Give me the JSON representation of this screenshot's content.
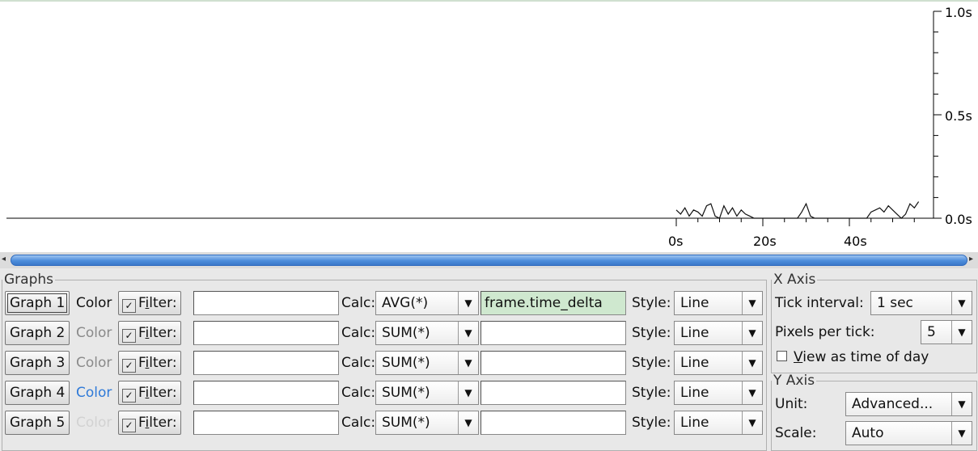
{
  "plot": {
    "y_ticks": [
      "1.0s",
      "0.5s",
      "0.0s"
    ],
    "x_ticks": [
      "0s",
      "20s",
      "40s"
    ]
  },
  "chart_data": {
    "type": "line",
    "series": [
      {
        "x": [
          0,
          1,
          2,
          3,
          4,
          5,
          6,
          7,
          8,
          9,
          10,
          11,
          12,
          13,
          14,
          15,
          16,
          17,
          18,
          19,
          20,
          21,
          22,
          23,
          24,
          25,
          26,
          27,
          28,
          29,
          30,
          31,
          32,
          33,
          34,
          35,
          36,
          37,
          38,
          39,
          40,
          41,
          42,
          43,
          44,
          45,
          46,
          47,
          48,
          49,
          50,
          51,
          52,
          53,
          54,
          55,
          56
        ],
        "values": [
          0.04,
          0.02,
          0.05,
          0.01,
          0.04,
          0.03,
          0.01,
          0.06,
          0.07,
          0.01,
          0.0,
          0.06,
          0.02,
          0.05,
          0.01,
          0.04,
          0.02,
          0.01,
          0.0,
          0.0,
          0.0,
          0.0,
          0.0,
          0.0,
          0.0,
          0.0,
          0.0,
          0.0,
          0.0,
          0.03,
          0.07,
          0.01,
          0.0,
          0.0,
          0.0,
          0.0,
          0.0,
          0.0,
          0.0,
          0.0,
          0.0,
          0.0,
          0.0,
          0.0,
          0.0,
          0.03,
          0.04,
          0.05,
          0.03,
          0.06,
          0.04,
          0.02,
          0.0,
          0.02,
          0.07,
          0.05,
          0.08
        ]
      }
    ],
    "xlim": [
      0,
      58
    ],
    "ylim": [
      0,
      1.0
    ],
    "x_unit": "s",
    "y_unit": "s"
  },
  "graphs": {
    "legend": "Graphs",
    "rows": [
      {
        "button": "Graph 1",
        "color_label": "Color",
        "color": "#111111",
        "filter_pre": "F",
        "filter_u": "i",
        "filter_post": "lter:",
        "filter_value": "",
        "calc_label": "Calc:",
        "calc": "AVG(*)",
        "field": "frame.time_delta",
        "style_label": "Style:",
        "style": "Line"
      },
      {
        "button": "Graph 2",
        "color_label": "Color",
        "color": "#8a8a8a",
        "filter_pre": "F",
        "filter_u": "i",
        "filter_post": "lter:",
        "filter_value": "",
        "calc_label": "Calc:",
        "calc": "SUM(*)",
        "field": "",
        "style_label": "Style:",
        "style": "Line"
      },
      {
        "button": "Graph 3",
        "color_label": "Color",
        "color": "#8a8a8a",
        "filter_pre": "F",
        "filter_u": "i",
        "filter_post": "lter:",
        "filter_value": "",
        "calc_label": "Calc:",
        "calc": "SUM(*)",
        "field": "",
        "style_label": "Style:",
        "style": "Line"
      },
      {
        "button": "Graph 4",
        "color_label": "Color",
        "color": "#2f7ad8",
        "filter_pre": "F",
        "filter_u": "i",
        "filter_post": "lter:",
        "filter_value": "",
        "calc_label": "Calc:",
        "calc": "SUM(*)",
        "field": "",
        "style_label": "Style:",
        "style": "Line"
      },
      {
        "button": "Graph 5",
        "color_label": "Color",
        "color": "#d2d2d2",
        "filter_pre": "F",
        "filter_u": "i",
        "filter_post": "lter:",
        "filter_value": "",
        "calc_label": "Calc:",
        "calc": "SUM(*)",
        "field": "",
        "style_label": "Style:",
        "style": "Line"
      }
    ]
  },
  "x_axis": {
    "legend": "X Axis",
    "tick_interval_label": "Tick interval:",
    "tick_interval": "1 sec",
    "pixels_per_tick_label": "Pixels per tick:",
    "pixels_per_tick": "5",
    "view_time_of_day_u": "V",
    "view_time_of_day_rest": "iew as time of day",
    "view_time_of_day_checked": false
  },
  "y_axis": {
    "legend": "Y Axis",
    "unit_label": "Unit:",
    "unit": "Advanced...",
    "scale_label": "Scale:",
    "scale": "Auto"
  },
  "colors": {
    "field_highlight": "#cfe8cf",
    "scroll_thumb": "#4d8ddb"
  }
}
